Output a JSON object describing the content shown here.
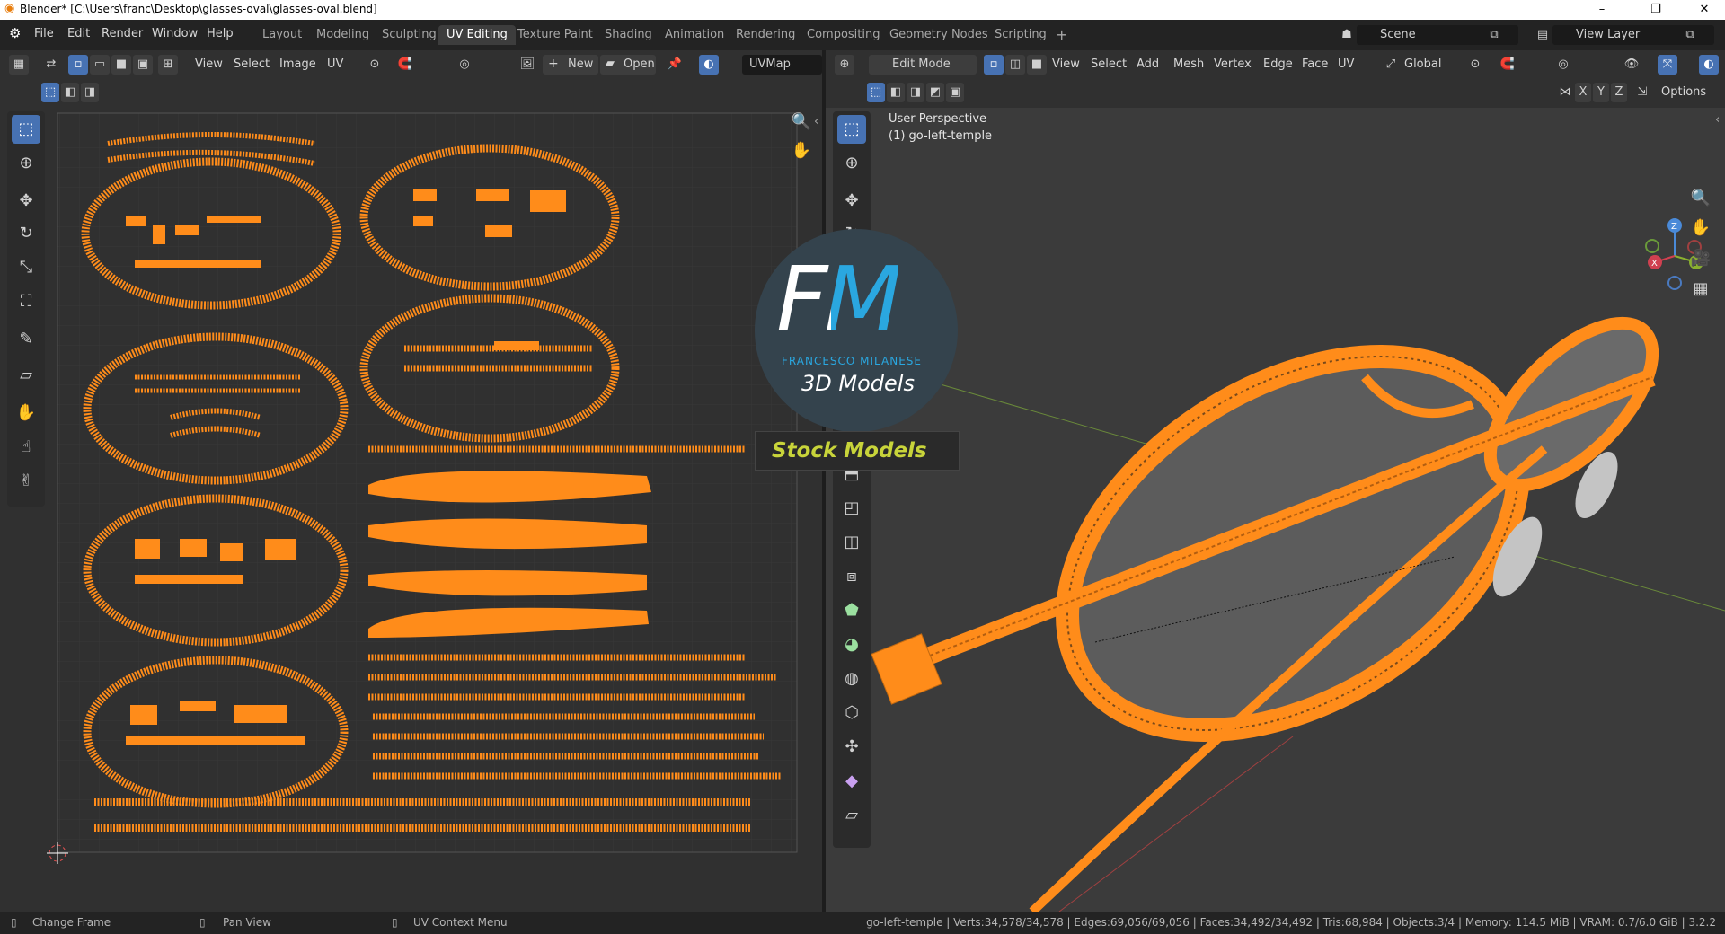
{
  "window": {
    "title": "Blender* [C:\\Users\\franc\\Desktop\\glasses-oval\\glasses-oval.blend]",
    "controls": [
      "minimize",
      "restore",
      "close"
    ]
  },
  "menu": [
    "File",
    "Edit",
    "Render",
    "Window",
    "Help"
  ],
  "workspaces": {
    "tabs": [
      "Layout",
      "Modeling",
      "Sculpting",
      "UV Editing",
      "Texture Paint",
      "Shading",
      "Animation",
      "Rendering",
      "Compositing",
      "Geometry Nodes",
      "Scripting"
    ],
    "active": "UV Editing",
    "add": "+"
  },
  "scene": {
    "label": "Scene"
  },
  "view_layer": {
    "label": "View Layer"
  },
  "uv_header": {
    "menus": [
      "View",
      "Select",
      "Image",
      "UV"
    ],
    "new_label": "New",
    "open_label": "Open",
    "uvmap_label": "UVMap"
  },
  "viewport_header": {
    "mode": "Edit Mode",
    "menus": [
      "View",
      "Select",
      "Add",
      "Mesh",
      "Vertex",
      "Edge",
      "Face",
      "UV"
    ],
    "orientation": "Global",
    "options_label": "Options",
    "axes": [
      "X",
      "Y",
      "Z"
    ]
  },
  "viewport_overlay": {
    "line1": "User Perspective",
    "line2": "(1) go-left-temple"
  },
  "gizmo": {
    "x": "X",
    "y": "Y",
    "z": "Z"
  },
  "watermark": {
    "logo": "FM",
    "brand": "FRANCESCO MILANESE",
    "sub": "3D Models",
    "banner": "Stock Models"
  },
  "statusbar": {
    "hints": [
      "Change Frame",
      "Pan View",
      "UV Context Menu"
    ],
    "stats": "go-left-temple | Verts:34,578/34,578 | Edges:69,056/69,056 | Faces:34,492/34,492 | Tris:68,984 | Objects:3/4 | Memory: 114.5 MiB | VRAM: 0.7/6.0 GiB | 3.2.2"
  },
  "colors": {
    "accent": "#4772b3",
    "uv_islands": "#ff8c1a",
    "wire": "#ff8c1a",
    "banner_text": "#c8d43a"
  },
  "icons": {
    "uv_tools": [
      "cursor-select-icon",
      "cursor-3d-icon",
      "move-icon",
      "rotate-icon",
      "scale-icon",
      "transform-icon",
      "annotate-icon",
      "shear-icon",
      "grab-icon",
      "relax-icon",
      "pinch-icon"
    ],
    "vp_tools": [
      "cursor-select-icon",
      "cursor-3d-icon",
      "move-icon",
      "rotate-icon",
      "extrude-icon",
      "inset-icon",
      "bevel-icon",
      "loopcut-icon",
      "knife-icon",
      "polybuild-icon",
      "spin-icon",
      "smooth-icon",
      "edge-slide-icon",
      "shrink-fatten-icon",
      "shear-icon",
      "rip-icon"
    ]
  }
}
